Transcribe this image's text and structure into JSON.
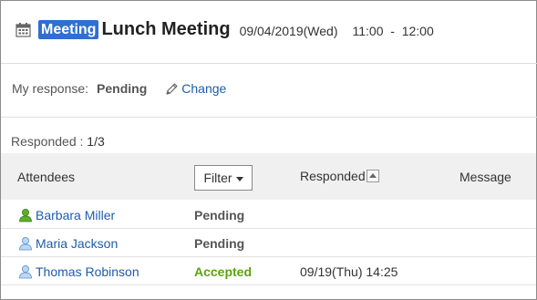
{
  "header": {
    "badge": "Meeting",
    "title": "Lunch Meeting",
    "date": "09/04/2019(Wed)",
    "time_range": "11:00  -  12:00"
  },
  "my_response": {
    "label": "My response:",
    "value": "Pending",
    "change_label": "Change"
  },
  "responded_summary": {
    "label": "Responded :",
    "count": "1/3"
  },
  "table": {
    "columns": {
      "attendees": "Attendees",
      "filter": "Filter",
      "responded": "Responded",
      "message": "Message"
    },
    "rows": [
      {
        "name": "Barbara Miller",
        "status": "Pending",
        "responded": "",
        "message": "",
        "icon": "user-icon-green"
      },
      {
        "name": "Maria Jackson",
        "status": "Pending",
        "responded": "",
        "message": "",
        "icon": "user-icon-blue"
      },
      {
        "name": "Thomas Robinson",
        "status": "Accepted",
        "responded": "09/19(Thu) 14:25",
        "message": "",
        "icon": "user-icon-blue"
      }
    ]
  },
  "colors": {
    "badge_bg": "#2f6fd1",
    "link": "#1d5da8",
    "pending": "#555555",
    "accepted": "#5aa313",
    "header_bg": "#f0f0f0"
  }
}
